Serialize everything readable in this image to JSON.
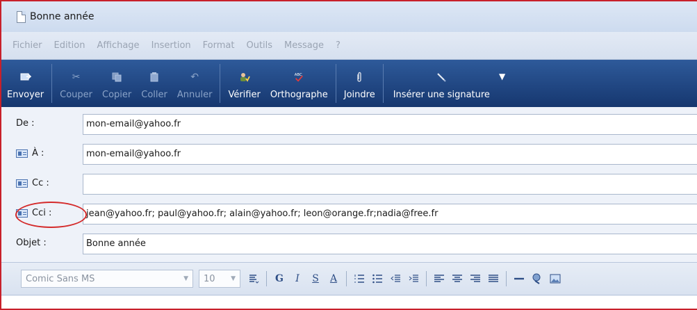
{
  "window": {
    "title": "Bonne année"
  },
  "menu": [
    "Fichier",
    "Edition",
    "Affichage",
    "Insertion",
    "Format",
    "Outils",
    "Message",
    "?"
  ],
  "toolbar": {
    "send": "Envoyer",
    "cut": "Couper",
    "copy": "Copier",
    "paste": "Coller",
    "undo": "Annuler",
    "check": "Vérifier",
    "spelling": "Orthographe",
    "attach": "Joindre",
    "signature": "Insérer une signature"
  },
  "fields": {
    "from": {
      "label": "De :",
      "value": "mon-email@yahoo.fr"
    },
    "to": {
      "label": "À :",
      "value": "mon-email@yahoo.fr"
    },
    "cc": {
      "label": "Cc :",
      "value": ""
    },
    "bcc": {
      "label": "Cci :",
      "value": "jean@yahoo.fr; paul@yahoo.fr; alain@yahoo.fr; leon@orange.fr;nadia@free.fr"
    },
    "subject": {
      "label": "Objet :",
      "value": "Bonne année"
    }
  },
  "format": {
    "font": "Comic Sans MS",
    "size": "10",
    "bold": "G",
    "italic": "I",
    "underline": "S",
    "color": "A"
  },
  "colors": {
    "toolbar": "#1f4785",
    "highlight": "#d42a2a",
    "window_border": "#c8202a"
  }
}
